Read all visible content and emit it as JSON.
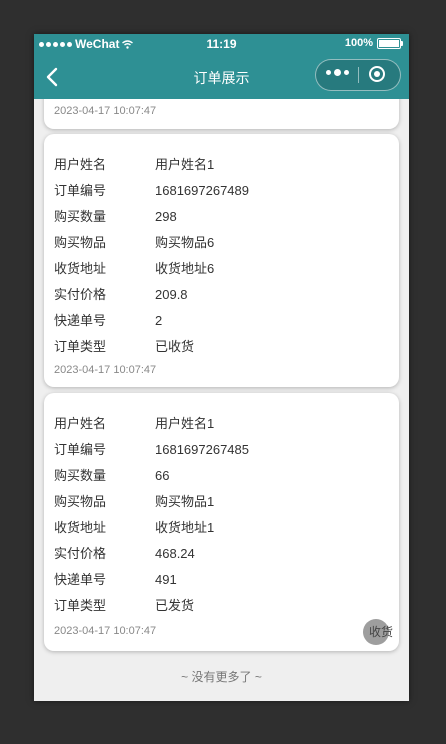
{
  "status_bar": {
    "carrier": "WeChat",
    "time": "11:19",
    "battery": "100%"
  },
  "nav": {
    "title": "订单展示"
  },
  "partial_card": {
    "timestamp": "2023-04-17 10:07:47"
  },
  "orders": [
    {
      "fields": [
        {
          "label": "用户姓名",
          "value": "用户姓名1"
        },
        {
          "label": "订单编号",
          "value": "1681697267489"
        },
        {
          "label": "购买数量",
          "value": "298"
        },
        {
          "label": "购买物品",
          "value": "购买物品6"
        },
        {
          "label": "收货地址",
          "value": "收货地址6"
        },
        {
          "label": "实付价格",
          "value": "209.8"
        },
        {
          "label": "快递单号",
          "value": "2"
        },
        {
          "label": "订单类型",
          "value": "已收货"
        }
      ],
      "timestamp": "2023-04-17 10:07:47"
    },
    {
      "fields": [
        {
          "label": "用户姓名",
          "value": "用户姓名1"
        },
        {
          "label": "订单编号",
          "value": "1681697267485"
        },
        {
          "label": "购买数量",
          "value": "66"
        },
        {
          "label": "购买物品",
          "value": "购买物品1"
        },
        {
          "label": "收货地址",
          "value": "收货地址1"
        },
        {
          "label": "实付价格",
          "value": "468.24"
        },
        {
          "label": "快递单号",
          "value": "491"
        },
        {
          "label": "订单类型",
          "value": "已发货"
        }
      ],
      "timestamp": "2023-04-17 10:07:47",
      "action_label": "收货"
    }
  ],
  "footer_text": "~ 没有更多了 ~",
  "colors": {
    "accent": "#2e9094",
    "background": "#efefef"
  }
}
